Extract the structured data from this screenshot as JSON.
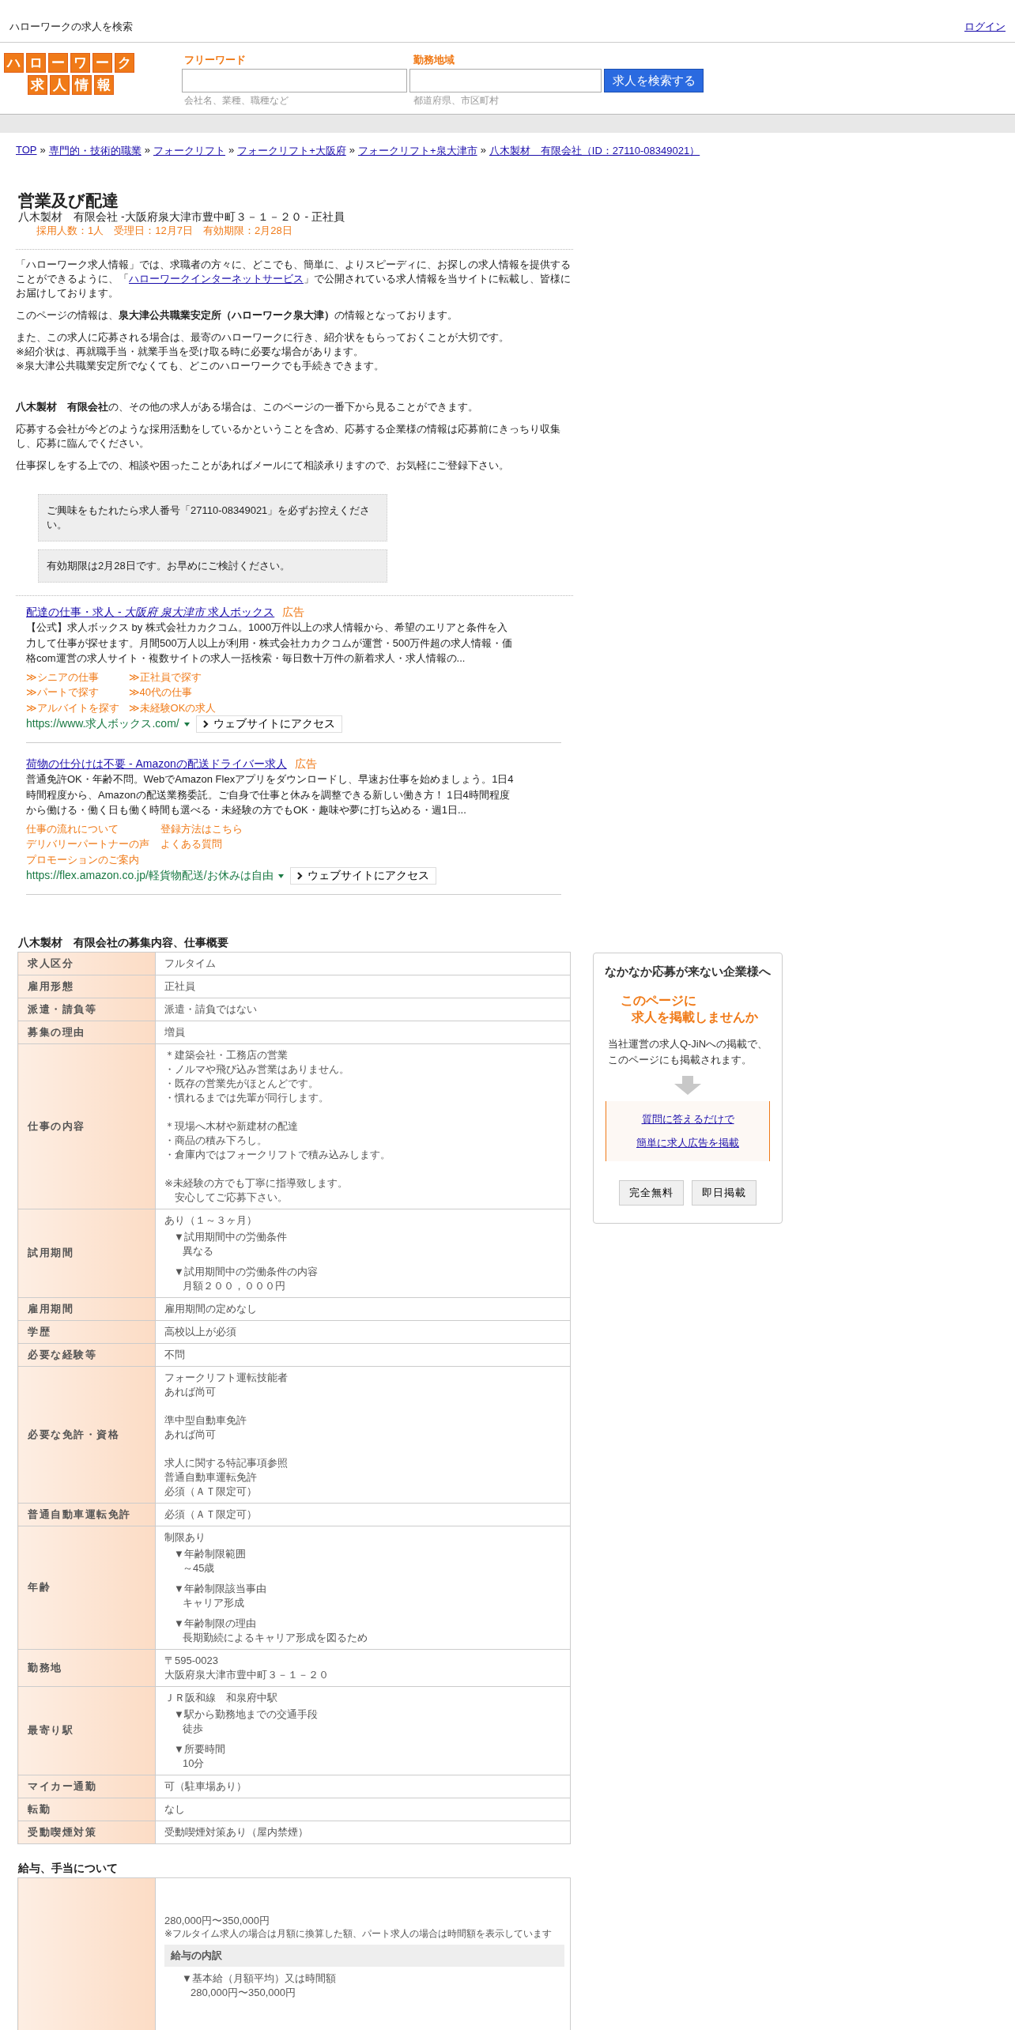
{
  "header": {
    "site_title": "ハローワークの求人を検索",
    "login": "ログイン"
  },
  "logo": {
    "row1": [
      "ハ",
      "ロ",
      "ー",
      "ワ",
      "ー",
      "ク"
    ],
    "row2": [
      "求",
      "人",
      "情",
      "報"
    ]
  },
  "search": {
    "fields": [
      {
        "label": "フリーワード",
        "hint": "会社名、業種、職種など"
      },
      {
        "label": "勤務地域",
        "hint": "都道府県、市区町村"
      }
    ],
    "button": "求人を検索する"
  },
  "breadcrumb": {
    "separator": "»",
    "items": [
      "TOP",
      "専門的・技術的職業",
      "フォークリフト",
      "フォークリフト+大阪府",
      "フォークリフト+泉大津市",
      "八木製材　有限会社（ID：27110-08349021）"
    ]
  },
  "job": {
    "title": "営業及び配達",
    "subtitle": "八木製材　有限会社 -大阪府泉大津市豊中町３－１－２０ - 正社員",
    "meta": "採用人数：1人　受理日：12月7日　有効期限：2月28日"
  },
  "intro": [
    [
      {
        "segments": [
          {
            "kind": "text",
            "text": "「ハローワーク求人情報」では、求職者の方々に、どこでも、簡単に、よりスピーディに、お探しの求人情報を提供することができるように、「"
          },
          {
            "kind": "link",
            "text": "ハローワークインターネットサービス"
          },
          {
            "kind": "text",
            "text": "」で公開されている求人情報を当サイトに転載し、皆様にお届けしております。"
          }
        ]
      },
      {
        "segments": [
          {
            "kind": "text",
            "text": "このページの情報は、**泉大津公共職業安定所（ハローワーク泉大津）**の情報となっております。"
          }
        ]
      },
      {
        "segments": [
          {
            "kind": "text",
            "text": "また、この求人に応募される場合は、最寄のハローワークに行き、紹介状をもらっておくことが大切です。"
          },
          {
            "kind": "break"
          },
          {
            "kind": "text",
            "text": "※紹介状は、再就職手当・就業手当を受け取る時に必要な場合があります。"
          },
          {
            "kind": "break"
          }
        ]
      },
      {
        "segments": [
          {
            "kind": "text",
            "text": "※泉大津公共職業安定所でなくても、どこのハローワークでも手続きできます。"
          }
        ]
      }
    ],
    [
      {
        "segments": [
          {
            "kind": "text",
            "text": "**八木製材　有限会社**の、その他の求人がある場合は、このページの一番下から見ることができます。"
          }
        ]
      },
      {
        "segments": [
          {
            "kind": "text",
            "text": "応募する会社が今どのような採用活動をしているかということを含め、応募する企業様の情報は応募前にきっちり収集し、応募に臨んでください。"
          }
        ]
      },
      {
        "segments": [
          {
            "kind": "text",
            "text": "仕事探しをする上での、相談や困ったことがあればメールにて相談承りますので、お気軽にご登録下さい。"
          }
        ]
      }
    ]
  ],
  "notices": [
    "ご興味をもたれたら求人番号「27110-08349021」を必ずお控えください。",
    "有効期限は2月28日です。お早めにご検討ください。"
  ],
  "ads": [
    {
      "title": "配達の仕事・求人 - *大阪府 泉大津市* 求人ボックス",
      "tag": "広告",
      "description": "【公式】求人ボックス by 株式会社カカクコム。1000万件以上の求人情報から、希望のエリアと条件を入力して仕事が探せます。月間500万人以上が利用・株式会社カカクコムが運営・500万件超の求人情報・価格com運営の求人サイト・複数サイトの求人一括検索・毎日数十万件の新着求人・求人情報の...",
      "sitelinks": [
        "≫シニアの仕事",
        "≫正社員で探す",
        "≫パートで探す",
        "≫40代の仕事",
        "≫アルバイトを探す",
        "≫未経験OKの求人"
      ],
      "url": "https://www.求人ボックス.com/",
      "button": "ウェブサイトにアクセス"
    },
    {
      "title": "荷物の仕分けは不要 - Amazonの配送ドライバー求人",
      "tag": "広告",
      "description": "普通免許OK・年齢不問。WebでAmazon Flexアプリをダウンロードし、早速お仕事を始めましょう。1日4時間程度から、Amazonの配送業務委託。ご自身で仕事と休みを調整できる新しい働き方！ 1日4時間程度から働ける・働く日も働く時間も選べる・未経験の方でもOK・趣味や夢に打ち込める・週1日...",
      "sitelinks": [
        "仕事の流れについて",
        "登録方法はこちら",
        "デリバリーパートナーの声",
        "よくある質問",
        "プロモーションのご案内"
      ],
      "url": "https://flex.amazon.co.jp/軽貨物配送/お休みは自由",
      "button": "ウェブサイトにアクセス"
    }
  ],
  "overview": {
    "title": "八木製材　有限会社の募集内容、仕事概要",
    "rows": [
      {
        "label": "求人区分",
        "main": [
          [
            "フルタイム"
          ]
        ]
      },
      {
        "label": "雇用形態",
        "main": [
          [
            "正社員"
          ]
        ]
      },
      {
        "label": "派遣・請負等",
        "main": [
          [
            "派遣・請負ではない"
          ]
        ]
      },
      {
        "label": "募集の理由",
        "main": [
          [
            "増員"
          ]
        ]
      },
      {
        "label": "仕事の内容",
        "main": [
          [
            "＊建築会社・工務店の営業",
            "・ノルマや飛び込み営業はありません。",
            "・既存の営業先がほとんどです。",
            "・慣れるまでは先輩が同行します。"
          ],
          [
            "＊現場へ木材や新建材の配達",
            "・商品の積み下ろし。",
            "・倉庫内ではフォークリフトで積み込みします。"
          ],
          [
            "※未経験の方でも丁寧に指導致します。",
            "　安心してご応募下さい。"
          ]
        ]
      },
      {
        "label": "試用期間",
        "main": [
          [
            "あり（１～３ヶ月）"
          ]
        ],
        "details": [
          {
            "heading": "▼試用期間中の労働条件",
            "text": "異なる"
          },
          {
            "heading": "▼試用期間中の労働条件の内容",
            "text": "月額２００，０００円"
          }
        ]
      },
      {
        "label": "雇用期間",
        "main": [
          [
            "雇用期間の定めなし"
          ]
        ]
      },
      {
        "label": "学歴",
        "main": [
          [
            "高校以上が必須"
          ]
        ]
      },
      {
        "label": "必要な経験等",
        "main": [
          [
            "不問"
          ]
        ]
      },
      {
        "label": "必要な免許・資格",
        "main": [
          [
            "フォークリフト運転技能者",
            "あれば尚可"
          ],
          [
            "準中型自動車免許",
            "あれば尚可"
          ],
          [
            "求人に関する特記事項参照",
            "普通自動車運転免許",
            "必須（ＡＴ限定可）"
          ]
        ]
      },
      {
        "label": "普通自動車運転免許",
        "main": [
          [
            "必須（ＡＴ限定可）"
          ]
        ]
      },
      {
        "label": "年齢",
        "main": [
          [
            "制限あり"
          ]
        ],
        "details": [
          {
            "heading": "▼年齢制限範囲",
            "text": "～45歳"
          },
          {
            "heading": "▼年齢制限該当事由",
            "text": "キャリア形成"
          },
          {
            "heading": "▼年齢制限の理由",
            "text": "長期勤続によるキャリア形成を図るため"
          }
        ]
      },
      {
        "label": "勤務地",
        "main": [
          [
            "〒595-0023",
            "大阪府泉大津市豊中町３－１－２０"
          ]
        ]
      },
      {
        "label": "最寄り駅",
        "main": [
          [
            "ＪＲ阪和線　和泉府中駅"
          ]
        ],
        "details": [
          {
            "heading": "▼駅から勤務地までの交通手段",
            "text": "徒歩"
          },
          {
            "heading": "▼所要時間",
            "text": "10分"
          }
        ]
      },
      {
        "label": "マイカー通勤",
        "main": [
          [
            "可（駐車場あり）"
          ]
        ]
      },
      {
        "label": "転勤",
        "main": [
          [
            "なし"
          ]
        ]
      },
      {
        "label": "受動喫煙対策",
        "main": [
          [
            "受動喫煙対策あり（屋内禁煙）"
          ]
        ]
      }
    ]
  },
  "salary": {
    "title": "給与、手当について",
    "amount": "280,000円〜350,000円",
    "note": "※フルタイム求人の場合は月額に換算した額、パート求人の場合は時間額を表示しています",
    "breakdown_title": "給与の内訳",
    "details": [
      {
        "heading": "▼基本給（月額平均）又は時間額",
        "text": "280,000円〜350,000円"
      }
    ]
  },
  "side_panel": {
    "title": "なかなか応募が来ない企業様へ",
    "headline": [
      "このページに",
      "求人を掲載しませんか"
    ],
    "description": [
      "当社運営の求人Q-JiNへの掲載で、",
      "このページにも掲載されます。"
    ],
    "links": [
      "質問に答えるだけで",
      "簡単に求人広告を掲載"
    ],
    "buttons": [
      "完全無料",
      "即日掲載"
    ]
  }
}
